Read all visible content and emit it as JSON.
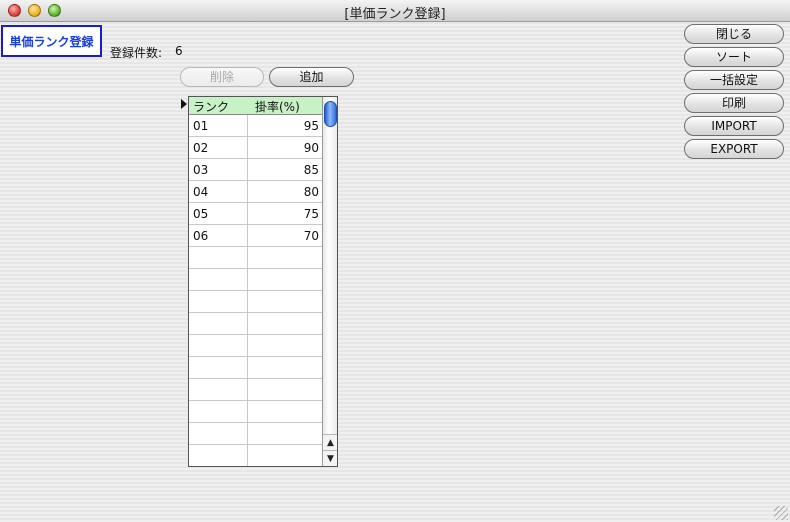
{
  "window": {
    "title": "[単価ランク登録]"
  },
  "header": {
    "badge": "単価ランク登録",
    "count_label": "登録件数:",
    "count_value": "6"
  },
  "toolbar": {
    "delete_label": "削除",
    "add_label": "追加"
  },
  "side_buttons": {
    "close": "閉じる",
    "sort": "ソート",
    "bulk_set": "一括設定",
    "print": "印刷",
    "import": "IMPORT",
    "export": "EXPORT"
  },
  "table": {
    "columns": [
      "ランク",
      "掛率(%)"
    ],
    "rows": [
      {
        "rank": "01",
        "rate": "95"
      },
      {
        "rank": "02",
        "rate": "90"
      },
      {
        "rank": "03",
        "rate": "85"
      },
      {
        "rank": "04",
        "rate": "80"
      },
      {
        "rank": "05",
        "rate": "75"
      },
      {
        "rank": "06",
        "rate": "70"
      }
    ],
    "header_bg": "#c6f2c6"
  },
  "icons": {
    "scroll_up": "▲",
    "scroll_down": "▼"
  }
}
